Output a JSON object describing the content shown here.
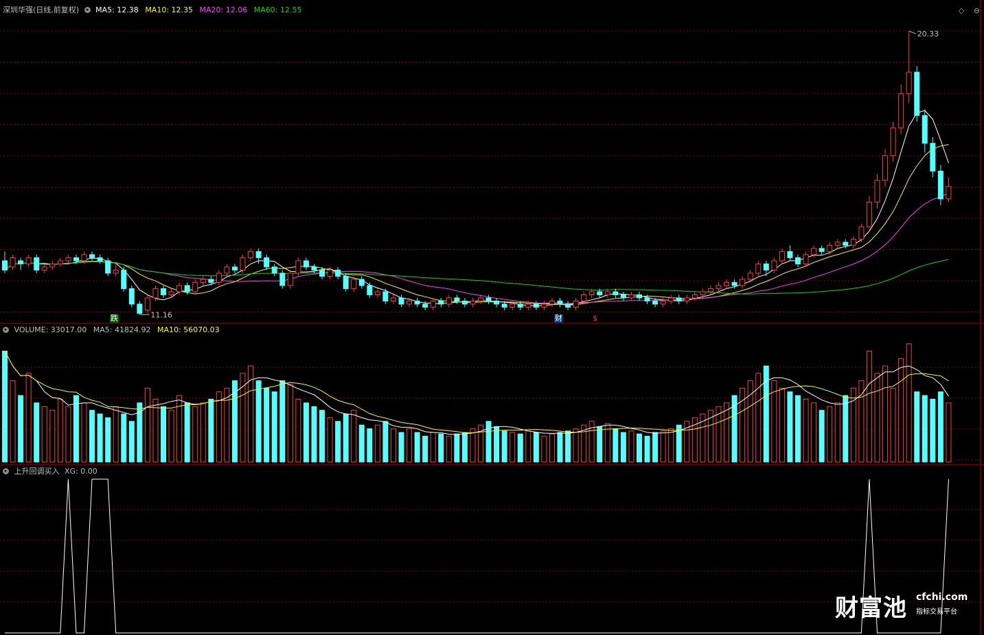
{
  "main_panel": {
    "title": "深圳华强(日线,前复权)",
    "ma5": {
      "label": "MA5: 12.38",
      "color": "#ffffff"
    },
    "ma10": {
      "label": "MA10: 12.35",
      "color": "#ffff00"
    },
    "ma20": {
      "label": "MA20: 12.06",
      "color": "#ff40ff"
    },
    "ma60": {
      "label": "MA60: 12.55",
      "color": "#00e000"
    },
    "high_label": "20.33",
    "low_label": "11.16",
    "markers": [
      {
        "text": "跌",
        "color": "#ffffff",
        "bg": "#006400"
      },
      {
        "text": "财",
        "color": "#ffffff",
        "bg": "#003a80"
      },
      {
        "text": "$",
        "color": "#ff3030",
        "bg": ""
      }
    ]
  },
  "volume_panel": {
    "volume": {
      "label": "VOLUME: 33017.00",
      "color": "#c0c0c0"
    },
    "ma5": {
      "label": "MA5: 41824.92",
      "color": "#c0c0c0"
    },
    "ma10": {
      "label": "MA10: 56070.03",
      "color": "#ffff00"
    }
  },
  "indicator_panel": {
    "title": "上升回调买入",
    "xg": {
      "label": "XG: 0.00",
      "color": "#c0c0c0"
    }
  },
  "top_icons": [
    "◇",
    "⊖"
  ],
  "watermark": {
    "brand": "财富池",
    "url": "cfchi.com",
    "tagline": "指标交易平台"
  },
  "colors": {
    "up": "#ff3c3c",
    "down": "#54ffff",
    "grid": "#8b0000",
    "frame": "#b40000"
  },
  "chart_data": {
    "type": "candlestick",
    "candles": [
      [
        12.9,
        12.6,
        12.5,
        13.2
      ],
      [
        12.7,
        13.0,
        12.6,
        13.1
      ],
      [
        12.9,
        12.8,
        12.6,
        13.0
      ],
      [
        12.8,
        13.0,
        12.7,
        13.1
      ],
      [
        13.0,
        12.6,
        12.5,
        13.1
      ],
      [
        12.6,
        12.7,
        12.5,
        12.8
      ],
      [
        12.7,
        12.8,
        12.6,
        12.9
      ],
      [
        12.8,
        12.9,
        12.7,
        13.0
      ],
      [
        12.9,
        13.0,
        12.8,
        13.1
      ],
      [
        13.0,
        12.9,
        12.8,
        13.1
      ],
      [
        12.9,
        13.1,
        12.8,
        13.2
      ],
      [
        13.1,
        13.0,
        12.9,
        13.2
      ],
      [
        13.0,
        12.9,
        12.8,
        13.1
      ],
      [
        12.9,
        12.5,
        12.4,
        13.0
      ],
      [
        12.5,
        12.6,
        12.4,
        12.8
      ],
      [
        12.6,
        12.0,
        11.9,
        12.7
      ],
      [
        12.0,
        11.5,
        11.4,
        12.1
      ],
      [
        11.5,
        11.2,
        11.16,
        11.6
      ],
      [
        11.3,
        11.7,
        11.2,
        11.8
      ],
      [
        11.7,
        12.0,
        11.6,
        12.1
      ],
      [
        12.0,
        11.8,
        11.7,
        12.1
      ],
      [
        11.8,
        11.9,
        11.7,
        12.0
      ],
      [
        11.9,
        12.1,
        11.8,
        12.2
      ],
      [
        12.1,
        11.9,
        11.8,
        12.2
      ],
      [
        11.9,
        12.2,
        11.8,
        12.3
      ],
      [
        12.2,
        12.3,
        12.1,
        12.4
      ],
      [
        12.3,
        12.2,
        12.1,
        12.4
      ],
      [
        12.2,
        12.5,
        12.1,
        12.6
      ],
      [
        12.5,
        12.7,
        12.4,
        12.8
      ],
      [
        12.7,
        12.6,
        12.5,
        12.8
      ],
      [
        12.6,
        13.0,
        12.5,
        13.1
      ],
      [
        13.0,
        13.2,
        12.9,
        13.3
      ],
      [
        13.2,
        13.0,
        12.8,
        13.3
      ],
      [
        13.0,
        12.7,
        12.6,
        13.1
      ],
      [
        12.7,
        12.5,
        12.4,
        12.8
      ],
      [
        12.5,
        12.1,
        12.0,
        12.6
      ],
      [
        12.1,
        12.5,
        12.0,
        12.6
      ],
      [
        12.5,
        12.9,
        12.4,
        13.0
      ],
      [
        12.9,
        12.7,
        12.6,
        13.0
      ],
      [
        12.7,
        12.6,
        12.5,
        12.8
      ],
      [
        12.6,
        12.4,
        12.3,
        12.7
      ],
      [
        12.4,
        12.6,
        12.3,
        12.7
      ],
      [
        12.6,
        12.4,
        12.3,
        12.7
      ],
      [
        12.4,
        12.0,
        11.9,
        12.5
      ],
      [
        12.0,
        12.3,
        11.9,
        12.4
      ],
      [
        12.3,
        12.1,
        12.0,
        12.4
      ],
      [
        12.1,
        11.8,
        11.7,
        12.2
      ],
      [
        11.8,
        11.9,
        11.7,
        12.0
      ],
      [
        11.9,
        11.6,
        11.5,
        12.0
      ],
      [
        11.6,
        11.7,
        11.5,
        11.8
      ],
      [
        11.7,
        11.5,
        11.4,
        11.8
      ],
      [
        11.5,
        11.6,
        11.4,
        11.7
      ],
      [
        11.6,
        11.5,
        11.4,
        11.7
      ],
      [
        11.5,
        11.4,
        11.3,
        11.6
      ],
      [
        11.4,
        11.6,
        11.3,
        11.7
      ],
      [
        11.6,
        11.5,
        11.4,
        11.7
      ],
      [
        11.5,
        11.7,
        11.4,
        11.8
      ],
      [
        11.7,
        11.6,
        11.5,
        11.8
      ],
      [
        11.6,
        11.5,
        11.4,
        11.7
      ],
      [
        11.5,
        11.6,
        11.4,
        11.7
      ],
      [
        11.6,
        11.7,
        11.5,
        11.8
      ],
      [
        11.7,
        11.6,
        11.5,
        11.8
      ],
      [
        11.6,
        11.5,
        11.4,
        11.7
      ],
      [
        11.5,
        11.4,
        11.3,
        11.6
      ],
      [
        11.4,
        11.5,
        11.3,
        11.6
      ],
      [
        11.5,
        11.4,
        11.3,
        11.6
      ],
      [
        11.4,
        11.5,
        11.3,
        11.6
      ],
      [
        11.5,
        11.4,
        11.3,
        11.6
      ],
      [
        11.4,
        11.5,
        11.3,
        11.6
      ],
      [
        11.5,
        11.6,
        11.4,
        11.7
      ],
      [
        11.6,
        11.5,
        11.4,
        11.7
      ],
      [
        11.5,
        11.4,
        11.3,
        11.6
      ],
      [
        11.4,
        11.6,
        11.3,
        11.7
      ],
      [
        11.6,
        11.8,
        11.5,
        11.9
      ],
      [
        11.8,
        11.9,
        11.7,
        12.0
      ],
      [
        11.9,
        11.8,
        11.7,
        12.0
      ],
      [
        11.8,
        11.9,
        11.7,
        12.0
      ],
      [
        11.9,
        11.8,
        11.7,
        12.0
      ],
      [
        11.8,
        11.7,
        11.6,
        11.9
      ],
      [
        11.7,
        11.8,
        11.6,
        11.9
      ],
      [
        11.8,
        11.7,
        11.6,
        11.9
      ],
      [
        11.7,
        11.6,
        11.5,
        11.8
      ],
      [
        11.6,
        11.5,
        11.4,
        11.7
      ],
      [
        11.5,
        11.6,
        11.4,
        11.7
      ],
      [
        11.6,
        11.7,
        11.5,
        11.8
      ],
      [
        11.7,
        11.6,
        11.5,
        11.8
      ],
      [
        11.6,
        11.7,
        11.5,
        11.8
      ],
      [
        11.7,
        11.8,
        11.6,
        11.9
      ],
      [
        11.8,
        11.9,
        11.7,
        12.0
      ],
      [
        11.9,
        12.0,
        11.8,
        12.1
      ],
      [
        12.0,
        12.1,
        11.9,
        12.2
      ],
      [
        12.1,
        12.2,
        12.0,
        12.3
      ],
      [
        12.2,
        12.1,
        12.0,
        12.3
      ],
      [
        12.1,
        12.3,
        12.0,
        12.4
      ],
      [
        12.3,
        12.5,
        12.2,
        12.6
      ],
      [
        12.5,
        12.8,
        12.4,
        12.9
      ],
      [
        12.8,
        12.6,
        12.4,
        12.9
      ],
      [
        12.6,
        12.9,
        12.5,
        13.0
      ],
      [
        12.9,
        13.2,
        12.8,
        13.3
      ],
      [
        13.2,
        13.0,
        12.9,
        13.4
      ],
      [
        13.0,
        12.8,
        12.7,
        13.1
      ],
      [
        12.8,
        13.1,
        12.7,
        13.2
      ],
      [
        13.1,
        13.3,
        13.0,
        13.4
      ],
      [
        13.3,
        13.2,
        13.1,
        13.4
      ],
      [
        13.2,
        13.4,
        13.1,
        13.5
      ],
      [
        13.4,
        13.5,
        13.3,
        13.6
      ],
      [
        13.5,
        13.4,
        13.3,
        13.6
      ],
      [
        13.4,
        13.6,
        13.3,
        13.7
      ],
      [
        13.6,
        14.0,
        13.5,
        14.1
      ],
      [
        14.0,
        14.8,
        13.9,
        15.0
      ],
      [
        14.8,
        15.5,
        14.6,
        15.7
      ],
      [
        15.5,
        16.3,
        15.3,
        16.5
      ],
      [
        16.3,
        17.2,
        16.1,
        17.4
      ],
      [
        17.2,
        18.3,
        17.0,
        18.6
      ],
      [
        18.3,
        19.0,
        18.0,
        20.33
      ],
      [
        19.0,
        17.6,
        17.4,
        19.2
      ],
      [
        17.6,
        16.7,
        16.4,
        17.8
      ],
      [
        16.7,
        15.8,
        15.6,
        16.9
      ],
      [
        15.8,
        14.9,
        14.7,
        16.0
      ],
      [
        14.9,
        15.3,
        14.8,
        15.6
      ]
    ],
    "volumes": [
      150,
      110,
      90,
      120,
      80,
      75,
      70,
      85,
      75,
      90,
      80,
      70,
      65,
      60,
      75,
      65,
      55,
      80,
      100,
      85,
      75,
      70,
      90,
      80,
      75,
      80,
      85,
      95,
      100,
      110,
      120,
      130,
      110,
      100,
      95,
      110,
      105,
      85,
      80,
      75,
      70,
      60,
      55,
      65,
      70,
      50,
      45,
      50,
      55,
      45,
      40,
      45,
      40,
      35,
      40,
      38,
      35,
      38,
      40,
      45,
      50,
      55,
      48,
      42,
      40,
      38,
      42,
      40,
      35,
      38,
      40,
      42,
      45,
      50,
      55,
      48,
      52,
      45,
      40,
      42,
      38,
      35,
      40,
      42,
      45,
      50,
      55,
      60,
      65,
      70,
      75,
      80,
      90,
      100,
      110,
      120,
      130,
      110,
      100,
      95,
      90,
      85,
      80,
      70,
      75,
      80,
      90,
      100,
      110,
      150,
      120,
      130,
      100,
      140,
      160,
      95,
      90,
      85,
      95,
      80
    ]
  }
}
